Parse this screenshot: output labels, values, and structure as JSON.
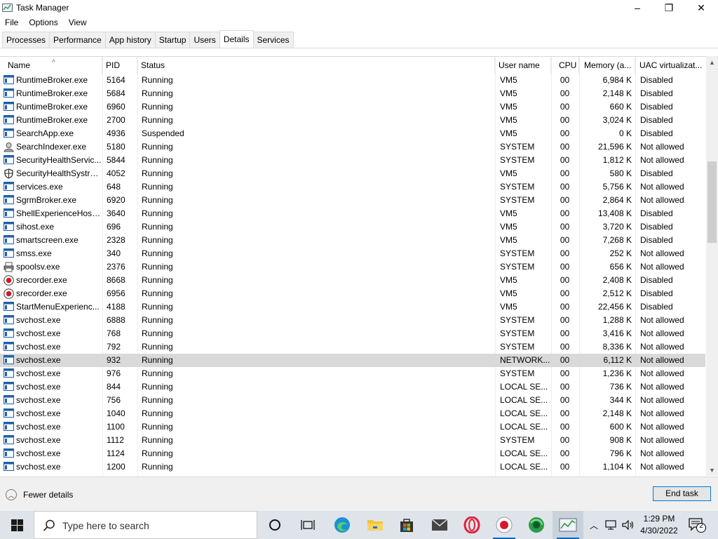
{
  "window": {
    "title": "Task Manager",
    "controls": {
      "minimize": "–",
      "maximize": "❐",
      "close": "✕"
    }
  },
  "menu": [
    "File",
    "Options",
    "View"
  ],
  "tabs": [
    {
      "label": "Processes",
      "active": false
    },
    {
      "label": "Performance",
      "active": false
    },
    {
      "label": "App history",
      "active": false
    },
    {
      "label": "Startup",
      "active": false
    },
    {
      "label": "Users",
      "active": false
    },
    {
      "label": "Details",
      "active": true
    },
    {
      "label": "Services",
      "active": false
    }
  ],
  "columns": {
    "name": "Name",
    "pid": "PID",
    "status": "Status",
    "user": "User name",
    "cpu": "CPU",
    "memory": "Memory (a...",
    "uac": "UAC virtualizat..."
  },
  "rows": [
    {
      "icon": "app-window",
      "name": "RuntimeBroker.exe",
      "pid": "5164",
      "status": "Running",
      "user": "VM5",
      "cpu": "00",
      "memory": "6,984 K",
      "uac": "Disabled"
    },
    {
      "icon": "app-window",
      "name": "RuntimeBroker.exe",
      "pid": "5684",
      "status": "Running",
      "user": "VM5",
      "cpu": "00",
      "memory": "2,148 K",
      "uac": "Disabled"
    },
    {
      "icon": "app-window",
      "name": "RuntimeBroker.exe",
      "pid": "6960",
      "status": "Running",
      "user": "VM5",
      "cpu": "00",
      "memory": "660 K",
      "uac": "Disabled"
    },
    {
      "icon": "app-window",
      "name": "RuntimeBroker.exe",
      "pid": "2700",
      "status": "Running",
      "user": "VM5",
      "cpu": "00",
      "memory": "3,024 K",
      "uac": "Disabled"
    },
    {
      "icon": "app-window",
      "name": "SearchApp.exe",
      "pid": "4936",
      "status": "Suspended",
      "user": "VM5",
      "cpu": "00",
      "memory": "0 K",
      "uac": "Disabled"
    },
    {
      "icon": "indexer",
      "name": "SearchIndexer.exe",
      "pid": "5180",
      "status": "Running",
      "user": "SYSTEM",
      "cpu": "00",
      "memory": "21,596 K",
      "uac": "Not allowed"
    },
    {
      "icon": "app-window",
      "name": "SecurityHealthServic...",
      "pid": "5844",
      "status": "Running",
      "user": "SYSTEM",
      "cpu": "00",
      "memory": "1,812 K",
      "uac": "Not allowed"
    },
    {
      "icon": "shield",
      "name": "SecurityHealthSystra...",
      "pid": "4052",
      "status": "Running",
      "user": "VM5",
      "cpu": "00",
      "memory": "580 K",
      "uac": "Disabled"
    },
    {
      "icon": "app-window",
      "name": "services.exe",
      "pid": "648",
      "status": "Running",
      "user": "SYSTEM",
      "cpu": "00",
      "memory": "5,756 K",
      "uac": "Not allowed"
    },
    {
      "icon": "app-window",
      "name": "SgrmBroker.exe",
      "pid": "6920",
      "status": "Running",
      "user": "SYSTEM",
      "cpu": "00",
      "memory": "2,864 K",
      "uac": "Not allowed"
    },
    {
      "icon": "app-window",
      "name": "ShellExperienceHost....",
      "pid": "3640",
      "status": "Running",
      "user": "VM5",
      "cpu": "00",
      "memory": "13,408 K",
      "uac": "Disabled"
    },
    {
      "icon": "app-window",
      "name": "sihost.exe",
      "pid": "696",
      "status": "Running",
      "user": "VM5",
      "cpu": "00",
      "memory": "3,720 K",
      "uac": "Disabled"
    },
    {
      "icon": "app-window",
      "name": "smartscreen.exe",
      "pid": "2328",
      "status": "Running",
      "user": "VM5",
      "cpu": "00",
      "memory": "7,268 K",
      "uac": "Disabled"
    },
    {
      "icon": "app-window",
      "name": "smss.exe",
      "pid": "340",
      "status": "Running",
      "user": "SYSTEM",
      "cpu": "00",
      "memory": "252 K",
      "uac": "Not allowed"
    },
    {
      "icon": "printer",
      "name": "spoolsv.exe",
      "pid": "2376",
      "status": "Running",
      "user": "SYSTEM",
      "cpu": "00",
      "memory": "656 K",
      "uac": "Not allowed"
    },
    {
      "icon": "record",
      "name": "srecorder.exe",
      "pid": "8668",
      "status": "Running",
      "user": "VM5",
      "cpu": "00",
      "memory": "2,408 K",
      "uac": "Disabled"
    },
    {
      "icon": "record",
      "name": "srecorder.exe",
      "pid": "6956",
      "status": "Running",
      "user": "VM5",
      "cpu": "00",
      "memory": "2,512 K",
      "uac": "Disabled"
    },
    {
      "icon": "app-window",
      "name": "StartMenuExperienc...",
      "pid": "4188",
      "status": "Running",
      "user": "VM5",
      "cpu": "00",
      "memory": "22,456 K",
      "uac": "Disabled"
    },
    {
      "icon": "app-window",
      "name": "svchost.exe",
      "pid": "6888",
      "status": "Running",
      "user": "SYSTEM",
      "cpu": "00",
      "memory": "1,288 K",
      "uac": "Not allowed"
    },
    {
      "icon": "app-window",
      "name": "svchost.exe",
      "pid": "768",
      "status": "Running",
      "user": "SYSTEM",
      "cpu": "00",
      "memory": "3,416 K",
      "uac": "Not allowed"
    },
    {
      "icon": "app-window",
      "name": "svchost.exe",
      "pid": "792",
      "status": "Running",
      "user": "SYSTEM",
      "cpu": "00",
      "memory": "8,336 K",
      "uac": "Not allowed"
    },
    {
      "icon": "app-window",
      "name": "svchost.exe",
      "pid": "932",
      "status": "Running",
      "user": "NETWORK...",
      "cpu": "00",
      "memory": "6,112 K",
      "uac": "Not allowed",
      "selected": true
    },
    {
      "icon": "app-window",
      "name": "svchost.exe",
      "pid": "976",
      "status": "Running",
      "user": "SYSTEM",
      "cpu": "00",
      "memory": "1,236 K",
      "uac": "Not allowed"
    },
    {
      "icon": "app-window",
      "name": "svchost.exe",
      "pid": "844",
      "status": "Running",
      "user": "LOCAL SE...",
      "cpu": "00",
      "memory": "736 K",
      "uac": "Not allowed"
    },
    {
      "icon": "app-window",
      "name": "svchost.exe",
      "pid": "756",
      "status": "Running",
      "user": "LOCAL SE...",
      "cpu": "00",
      "memory": "344 K",
      "uac": "Not allowed"
    },
    {
      "icon": "app-window",
      "name": "svchost.exe",
      "pid": "1040",
      "status": "Running",
      "user": "LOCAL SE...",
      "cpu": "00",
      "memory": "2,148 K",
      "uac": "Not allowed"
    },
    {
      "icon": "app-window",
      "name": "svchost.exe",
      "pid": "1100",
      "status": "Running",
      "user": "LOCAL SE...",
      "cpu": "00",
      "memory": "600 K",
      "uac": "Not allowed"
    },
    {
      "icon": "app-window",
      "name": "svchost.exe",
      "pid": "1112",
      "status": "Running",
      "user": "SYSTEM",
      "cpu": "00",
      "memory": "908 K",
      "uac": "Not allowed"
    },
    {
      "icon": "app-window",
      "name": "svchost.exe",
      "pid": "1124",
      "status": "Running",
      "user": "LOCAL SE...",
      "cpu": "00",
      "memory": "796 K",
      "uac": "Not allowed"
    },
    {
      "icon": "app-window",
      "name": "svchost.exe",
      "pid": "1200",
      "status": "Running",
      "user": "LOCAL SE...",
      "cpu": "00",
      "memory": "1,104 K",
      "uac": "Not allowed"
    }
  ],
  "footer": {
    "fewer_details": "Fewer details",
    "end_task": "End task"
  },
  "taskbar": {
    "search_placeholder": "Type here to search",
    "time": "1:29 PM",
    "date": "4/30/2022",
    "notification_count": "2",
    "pinned": [
      "task-view",
      "cortana",
      "edge",
      "file-explorer",
      "store",
      "mail",
      "opera",
      "recorder",
      "edge-dev",
      "task-manager"
    ]
  },
  "colors": {
    "selected_row": "#d9d9d9",
    "accent": "#0078d7",
    "taskbar": "#dfe4ea"
  }
}
